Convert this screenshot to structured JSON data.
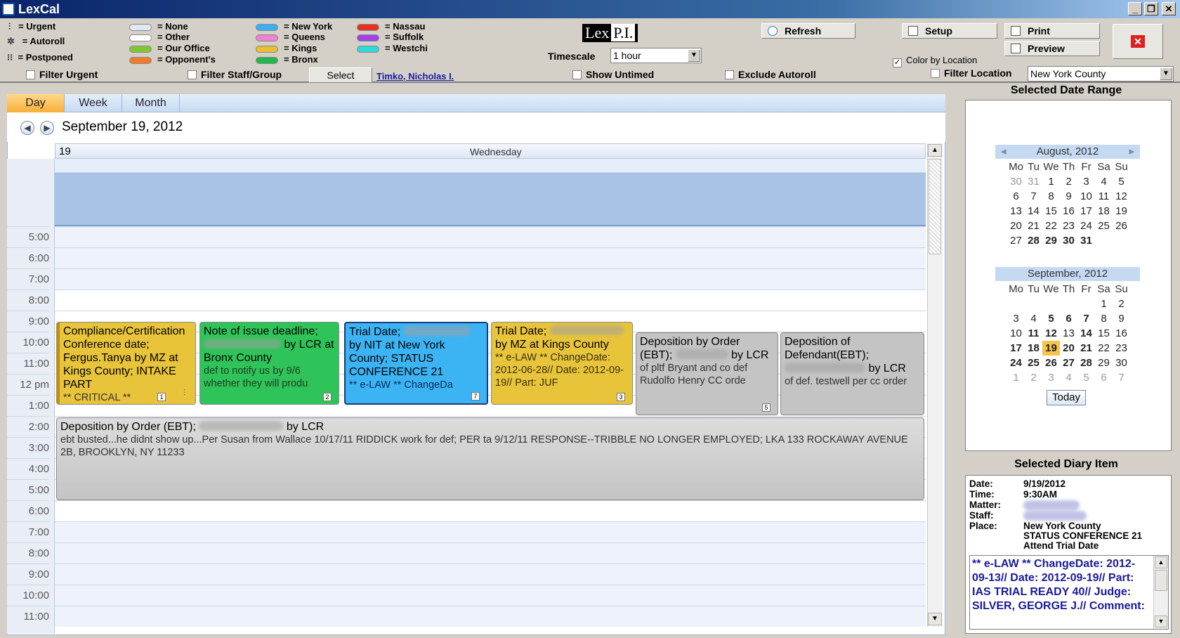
{
  "window": {
    "title": "LexCal",
    "minimize": "_",
    "restore": "❐",
    "close": "✕"
  },
  "legend": {
    "status": [
      {
        "icon": "urgent-icon",
        "label": "= Urgent"
      },
      {
        "icon": "autoroll-icon",
        "label": "= Autoroll"
      },
      {
        "icon": "postponed-icon",
        "label": "= Postponed"
      }
    ],
    "staff": [
      {
        "color": "#dfe8f5",
        "label": "= None"
      },
      {
        "color": "#ffffff",
        "label": "= Other"
      },
      {
        "color": "#7fc832",
        "label": "= Our Office"
      },
      {
        "color": "#f07c2a",
        "label": "= Opponent's"
      }
    ],
    "locations1": [
      {
        "color": "#3ab0f0",
        "label": "= New York"
      },
      {
        "color": "#f080d0",
        "label": "= Queens"
      },
      {
        "color": "#e8c030",
        "label": "= Kings"
      },
      {
        "color": "#20b848",
        "label": "= Bronx"
      }
    ],
    "locations2": [
      {
        "color": "#e83020",
        "label": "= Nassau"
      },
      {
        "color": "#a040e8",
        "label": "= Suffolk"
      },
      {
        "color": "#30d8d8",
        "label": "= Westchi"
      }
    ]
  },
  "toolbar": {
    "logo_lex": "Lex",
    "logo_pi": "P.I.",
    "timescale_label": "Timescale",
    "timescale_value": "1 hour",
    "refresh": "Refresh",
    "setup": "Setup",
    "print": "Print",
    "preview": "Preview",
    "color_by_location": "Color by Location",
    "filter_urgent": "Filter Urgent",
    "filter_staff": "Filter Staff/Group",
    "select": "Select",
    "staff_name": "Timko, Nicholas I.",
    "show_untimed": "Show Untimed",
    "exclude_autoroll": "Exclude Autoroll",
    "filter_location": "Filter Location",
    "location_value": "New York County"
  },
  "tabs": [
    "Day",
    "Week",
    "Month"
  ],
  "calendar": {
    "date_title": "September 19, 2012",
    "day_num": "19",
    "day_name": "Wednesday",
    "times": [
      "5:00",
      "6:00",
      "7:00",
      "8:00",
      "9:00",
      "10:00",
      "11:00",
      "12 pm",
      "1:00",
      "2:00",
      "3:00",
      "4:00",
      "5:00",
      "6:00",
      "7:00",
      "8:00",
      "9:00",
      "10:00",
      "11:00"
    ]
  },
  "appointments": [
    {
      "title": "Compliance/Certification Conference date; Fergus.Tanya by MZ at Kings County; INTAKE PART",
      "sub": "** CRITICAL **",
      "badge": "1",
      "color": "#e8c43a"
    },
    {
      "title": "Note of issue deadline;",
      "title2": "by LCR at Bronx County",
      "sub": "def to notify us by 9/6 whether they will produ",
      "badge": "2",
      "color": "#2fc45a"
    },
    {
      "title": "Trial Date;",
      "title2": "by NIT at New York County; STATUS CONFERENCE 21",
      "sub": "** e-LAW ** ChangeDa",
      "badge": "7",
      "color": "#3cb4f4"
    },
    {
      "title": "Trial Date;",
      "title2": "by MZ at Kings County",
      "sub": "** e-LAW ** ChangeDate: 2012-06-28// Date: 2012-09-19// Part: JUF",
      "badge": "3",
      "color": "#e8c43a"
    },
    {
      "title": "Deposition by Order (EBT);",
      "title2": "by LCR",
      "sub": "of pltf Bryant and co def Rudolfo Henry CC orde",
      "badge": "5",
      "color": "#c4c4c4"
    },
    {
      "title": "Deposition of Defendant(EBT);",
      "title2": "by LCR",
      "sub": "of def. testwell per cc order",
      "badge": "",
      "color": "#c4c4c4"
    },
    {
      "title": "Deposition by Order (EBT);",
      "title2": "by LCR",
      "sub": "ebt busted...he didnt show up...Per Susan from Wallace 10/17/11 RIDDICK work for def; PER ta 9/12/11 RESPONSE--TRIBBLE NO LONGER EMPLOYED; LKA 133 ROCKAWAY AVENUE 2B, BROOKLYN, NY 11233",
      "badge": "",
      "color": "#c8c8c8"
    }
  ],
  "right_panel": {
    "date_range_title": "Selected Date Range",
    "aug_title": "August, 2012",
    "sep_title": "September, 2012",
    "dow": [
      "Mo",
      "Tu",
      "We",
      "Th",
      "Fr",
      "Sa",
      "Su"
    ],
    "aug_weeks": [
      [
        "30",
        "31",
        "1",
        "2",
        "3",
        "4",
        "5"
      ],
      [
        "6",
        "7",
        "8",
        "9",
        "10",
        "11",
        "12"
      ],
      [
        "13",
        "14",
        "15",
        "16",
        "17",
        "18",
        "19"
      ],
      [
        "20",
        "21",
        "22",
        "23",
        "24",
        "25",
        "26"
      ],
      [
        "27",
        "28",
        "29",
        "30",
        "31",
        "",
        ""
      ]
    ],
    "sep_weeks": [
      [
        "",
        "",
        "",
        "",
        "",
        "1",
        "2"
      ],
      [
        "3",
        "4",
        "5",
        "6",
        "7",
        "8",
        "9"
      ],
      [
        "10",
        "11",
        "12",
        "13",
        "14",
        "15",
        "16"
      ],
      [
        "17",
        "18",
        "19",
        "20",
        "21",
        "22",
        "23"
      ],
      [
        "24",
        "25",
        "26",
        "27",
        "28",
        "29",
        "30"
      ],
      [
        "1",
        "2",
        "3",
        "4",
        "5",
        "6",
        "7"
      ]
    ],
    "today": "Today",
    "diary_title": "Selected Diary Item",
    "diary": {
      "date_label": "Date:",
      "date": "9/19/2012",
      "time_label": "Time:",
      "time": "9:30AM",
      "matter_label": "Matter:",
      "staff_label": "Staff:",
      "place_label": "Place:",
      "place": "New York County",
      "line2": "STATUS CONFERENCE 21",
      "line3": "Attend Trial Date"
    },
    "note": "** e-LAW ** ChangeDate: 2012-09-13// Date: 2012-09-19// Part: IAS TRIAL READY 40// Judge: SILVER, GEORGE J.// Comment:"
  }
}
